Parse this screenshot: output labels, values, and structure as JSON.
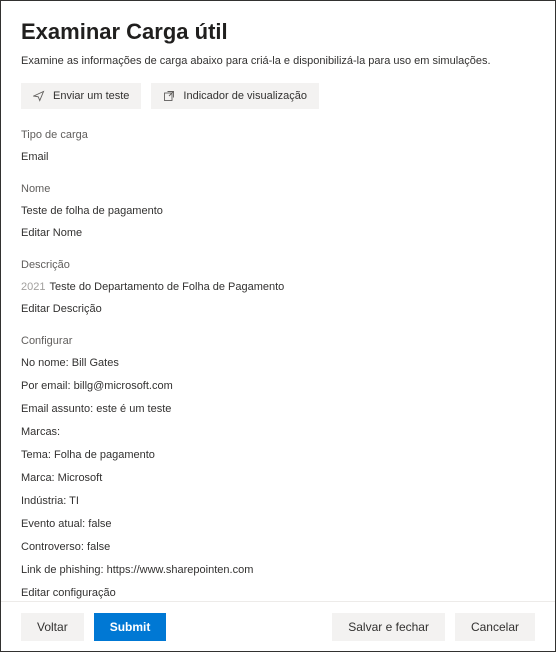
{
  "header": {
    "title": "Examinar Carga útil",
    "subtitle": "Examine as informações de carga abaixo para criá-la e disponibilizá-la para uso em simulações."
  },
  "toolbar": {
    "send_test": "Enviar um teste",
    "preview_indicator": "Indicador de visualização"
  },
  "payload_type": {
    "label": "Tipo de carga",
    "value": "Email"
  },
  "name": {
    "label": "Nome",
    "value": "Teste de folha de pagamento",
    "edit": "Editar Nome"
  },
  "description": {
    "label": "Descrição",
    "year": "2021",
    "value": "Teste do Departamento de Folha de Pagamento",
    "edit": "Editar Descrição"
  },
  "configure": {
    "label": "Configurar",
    "from_name": "No nome: Bill Gates",
    "from_email": "Por email: billg@microsoft.com",
    "email_subject": "Email assunto: este é um teste",
    "tags": "Marcas:",
    "theme": "Tema: Folha de pagamento",
    "brand": "Marca: Microsoft",
    "industry": "Indústria: TI",
    "current_event": "Evento atual: false",
    "controversial": "Controverso: false",
    "phishing_link": "Link de phishing: https://www.sharepointen.com",
    "edit": "Editar configuração"
  },
  "footer": {
    "back": "Voltar",
    "submit": "Submit",
    "save_close": "Salvar e fechar",
    "cancel": "Cancelar"
  }
}
